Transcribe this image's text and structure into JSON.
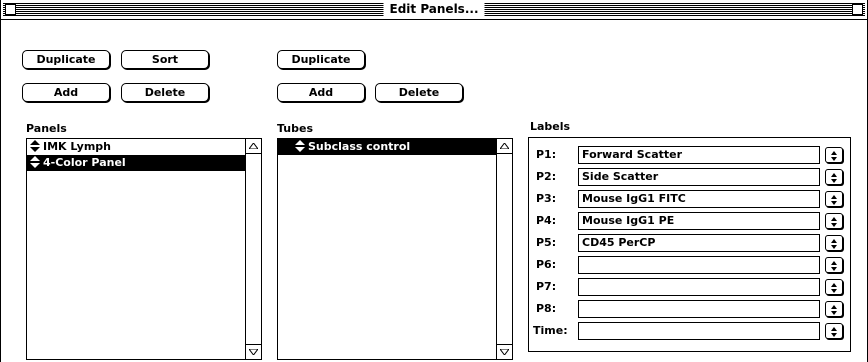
{
  "window": {
    "title": "Edit Panels..."
  },
  "panels_group": {
    "label": "Panels",
    "buttons": {
      "duplicate": "Duplicate",
      "sort": "Sort",
      "add": "Add",
      "delete": "Delete"
    },
    "items": [
      {
        "label": "IMK Lymph",
        "selected": false
      },
      {
        "label": "4-Color Panel",
        "selected": true
      }
    ]
  },
  "tubes_group": {
    "label": "Tubes",
    "buttons": {
      "duplicate": "Duplicate",
      "add": "Add",
      "delete": "Delete"
    },
    "items": [
      {
        "label": "Subclass control",
        "selected": true
      }
    ]
  },
  "labels_group": {
    "label": "Labels",
    "rows": [
      {
        "name": "P1:",
        "value": "Forward Scatter"
      },
      {
        "name": "P2:",
        "value": "Side Scatter"
      },
      {
        "name": "P3:",
        "value": "Mouse IgG1 FITC"
      },
      {
        "name": "P4:",
        "value": "Mouse IgG1 PE"
      },
      {
        "name": "P5:",
        "value": "CD45 PerCP"
      },
      {
        "name": "P6:",
        "value": ""
      },
      {
        "name": "P7:",
        "value": ""
      },
      {
        "name": "P8:",
        "value": ""
      },
      {
        "name": "Time:",
        "value": ""
      }
    ]
  },
  "icons": {
    "list_item": "up-down-arrows-icon",
    "popup": "up-down-popup-icon",
    "scroll_up": "scroll-up-arrow-icon",
    "scroll_down": "scroll-down-arrow-icon"
  }
}
